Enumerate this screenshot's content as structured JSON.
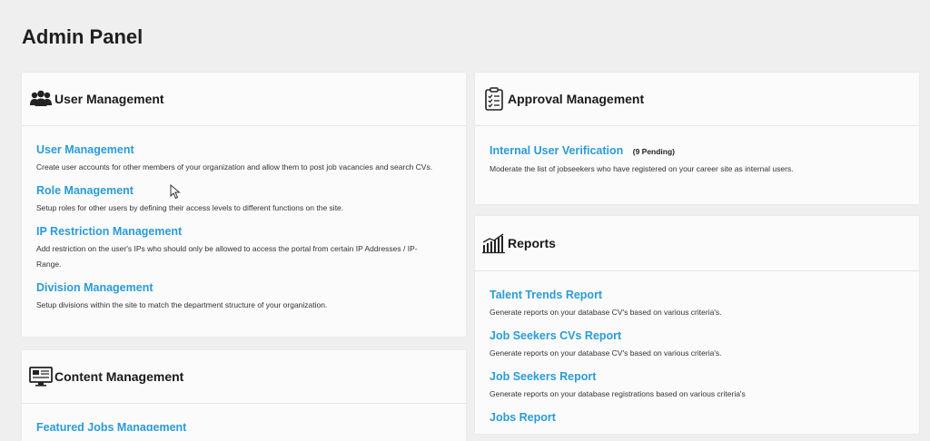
{
  "page": {
    "title": "Admin Panel"
  },
  "user_management": {
    "title": "User Management",
    "icon": "users-icon",
    "items": [
      {
        "label": "User Management",
        "desc": "Create user accounts for other members of your organization and allow them to post job vacancies and search CVs."
      },
      {
        "label": "Role Management",
        "desc": "Setup roles for other users by defining their access levels to different functions on the site."
      },
      {
        "label": "IP Restriction Management",
        "desc": "Add restriction on the user's IPs who should only be allowed to access the portal from certain IP Addresses / IP-Range."
      },
      {
        "label": "Division Management",
        "desc": "Setup divisions within the site to match the department structure of your organization."
      }
    ]
  },
  "approval_management": {
    "title": "Approval Management",
    "icon": "clipboard-checklist-icon",
    "items": [
      {
        "label": "Internal User Verification",
        "badge": "(9 Pending)",
        "desc": "Moderate the list of jobseekers who have registered on your career site as internal users."
      }
    ]
  },
  "reports": {
    "title": "Reports",
    "icon": "bar-chart-icon",
    "items": [
      {
        "label": "Talent Trends Report",
        "desc": "Generate reports on your database CV's based on various criteria's."
      },
      {
        "label": "Job Seekers CVs Report",
        "desc": "Generate reports on your database CV's based on various criteria's."
      },
      {
        "label": "Job Seekers Report",
        "desc": "Generate reports on your database registrations based on various criteria's"
      },
      {
        "label": "Jobs Report",
        "desc": ""
      }
    ]
  },
  "content_management": {
    "title": "Content Management",
    "icon": "monitor-icon",
    "items": [
      {
        "label": "Featured Jobs Management"
      }
    ]
  }
}
